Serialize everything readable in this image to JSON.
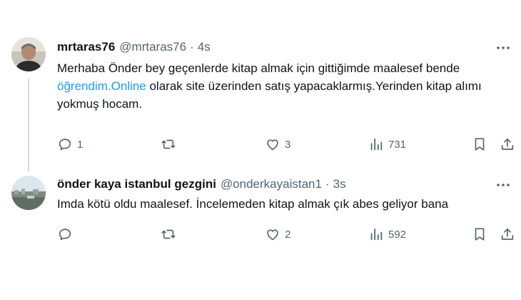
{
  "tweets": [
    {
      "display_name": "mrtaras76",
      "handle": "@mrtaras76",
      "separator": "·",
      "time": "4s",
      "text_before_link": "Merhaba Önder bey geçenlerde kitap almak için gittiğimde maalesef bende ",
      "link_text": "öğrendim.Online",
      "text_after_link": " olarak site üzerinden satış yapacaklarmış.Yerinden kitap alımı yokmuş hocam.",
      "reply_count": "1",
      "retweet_count": "",
      "like_count": "3",
      "view_count": "731"
    },
    {
      "display_name": "önder kaya istanbul gezgini",
      "handle": "@onderkayaistan1",
      "separator": "·",
      "time": "3s",
      "text": "Imda kötü oldu maalesef. İncelemeden kitap almak çık abes geliyor bana",
      "reply_count": "",
      "retweet_count": "",
      "like_count": "2",
      "view_count": "592"
    }
  ],
  "icons": [
    "more-icon",
    "reply-icon",
    "retweet-icon",
    "like-icon",
    "views-icon",
    "bookmark-icon",
    "share-icon"
  ],
  "colors": {
    "link": "#1d9bf0",
    "secondary": "#536471",
    "thread_line": "#cfd9de"
  }
}
